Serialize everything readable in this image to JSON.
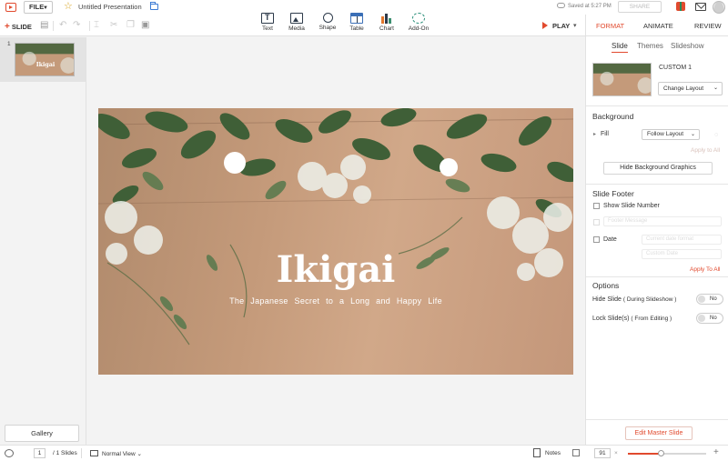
{
  "app": {
    "file_menu": "FILE",
    "doc_title": "Untitled Presentation",
    "saved_status": "Saved at 5:27 PM",
    "share_label": "SHARE"
  },
  "toolbar": {
    "add_slide_label": "SLIDE",
    "insert": [
      {
        "label": "Text",
        "icon": "text-icon"
      },
      {
        "label": "Media",
        "icon": "media-icon"
      },
      {
        "label": "Shape",
        "icon": "shape-icon"
      },
      {
        "label": "Table",
        "icon": "table-icon"
      },
      {
        "label": "Chart",
        "icon": "chart-icon"
      },
      {
        "label": "Add-On",
        "icon": "addon-icon"
      }
    ],
    "play_label": "PLAY"
  },
  "slides_panel": {
    "slide_number": "1",
    "gallery_label": "Gallery"
  },
  "slide": {
    "title": "Ikigai",
    "subtitle": "The Japanese Secret to a Long and Happy Life"
  },
  "right_panel": {
    "tabs": [
      "FORMAT",
      "ANIMATE",
      "REVIEW"
    ],
    "active_tab": "FORMAT",
    "subtabs": [
      "Slide",
      "Themes",
      "Slideshow"
    ],
    "active_subtab": "Slide",
    "layout_name": "CUSTOM 1",
    "change_layout_label": "Change Layout",
    "background": {
      "title": "Background",
      "fill_label": "Fill",
      "fill_value": "Follow Layout",
      "apply_to_all": "Apply to All",
      "hide_bg_graphics": "Hide Background Graphics"
    },
    "footer": {
      "title": "Slide Footer",
      "show_slide_number": "Show Slide Number",
      "footer_message": "Footer Message",
      "date_label": "Date",
      "date_field_1": "Current date format",
      "date_field_2": "Custom Date",
      "apply_to_all": "Apply To All"
    },
    "options": {
      "title": "Options",
      "hide_slide_label": "Hide Slide",
      "hide_slide_hint": "( During Slideshow )",
      "hide_slide_value": "No",
      "lock_slide_label": "Lock Slide(s)",
      "lock_slide_hint": "( From Editing )",
      "lock_slide_value": "No"
    },
    "edit_master_label": "Edit Master Slide"
  },
  "statusbar": {
    "current_page": "1",
    "total_slides": "/ 1 Slides",
    "view_mode": "Normal View",
    "notes_label": "Notes",
    "zoom_value": "91",
    "zoom_fraction": 0.42
  },
  "colors": {
    "accent": "#e14a2e",
    "slide_wood": "#c49a7a",
    "leaf_green": "#3f5f37"
  }
}
